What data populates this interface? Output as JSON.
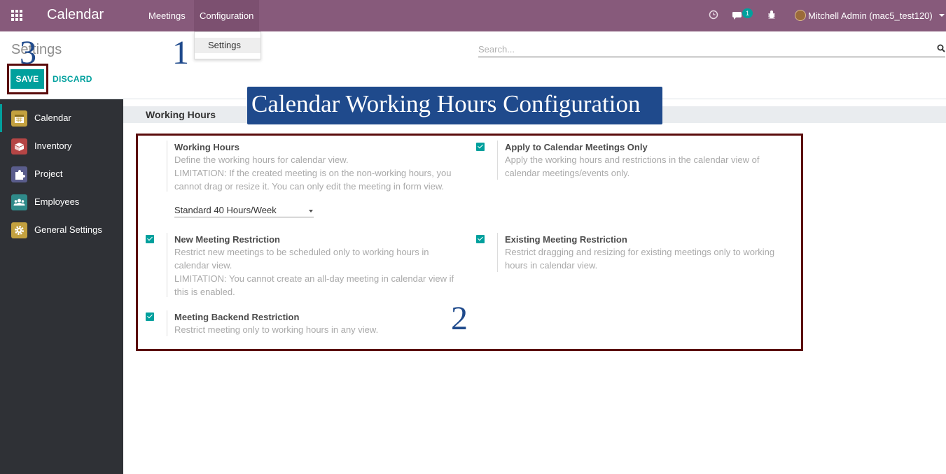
{
  "navbar": {
    "app_name": "Calendar",
    "menus": [
      "Meetings",
      "Configuration"
    ],
    "messages_count": "1",
    "user": "Mitchell Admin (mac5_test120)",
    "bg_color": "#875a7b"
  },
  "config_dropdown": {
    "items": [
      "Settings"
    ]
  },
  "control_panel": {
    "title": "Settings",
    "search_placeholder": "Search...",
    "save_label": "SAVE",
    "discard_label": "DISCARD"
  },
  "sidebar": {
    "items": [
      {
        "label": "Calendar",
        "icon": "calendar-icon",
        "active": true
      },
      {
        "label": "Inventory",
        "icon": "inventory-icon"
      },
      {
        "label": "Project",
        "icon": "puzzle-icon"
      },
      {
        "label": "Employees",
        "icon": "people-icon"
      },
      {
        "label": "General Settings",
        "icon": "gear-icon"
      }
    ]
  },
  "banner": "Calendar Working Hours Configuration",
  "section": {
    "title": "Working Hours",
    "settings": [
      {
        "title": "Working Hours",
        "desc": [
          "Define the working hours for calendar view.",
          "LIMITATION: If the created meeting is on the non-working hours, you",
          "cannot drag or resize it. You can only edit the meeting in form view."
        ],
        "select_value": "Standard 40 Hours/Week"
      },
      {
        "title": "Apply to Calendar Meetings Only",
        "desc": [
          "Apply the working hours and restrictions in the calendar view of",
          "calendar meetings/events only."
        ],
        "checked": true
      },
      {
        "title": "New Meeting Restriction",
        "desc": [
          "Restrict new meetings to be scheduled only to working hours in",
          "calendar view.",
          "LIMITATION: You cannot create an all-day meeting in calendar view if",
          "this is enabled."
        ],
        "checked": true
      },
      {
        "title": "Existing Meeting Restriction",
        "desc": [
          "Restrict dragging and resizing for existing meetings only to working",
          "hours in calendar view."
        ],
        "checked": true
      },
      {
        "title": "Meeting Backend Restriction",
        "desc": [
          "Restrict meeting only to working hours in any view."
        ],
        "checked": true
      }
    ]
  },
  "annotations": [
    "1",
    "2",
    "3"
  ]
}
